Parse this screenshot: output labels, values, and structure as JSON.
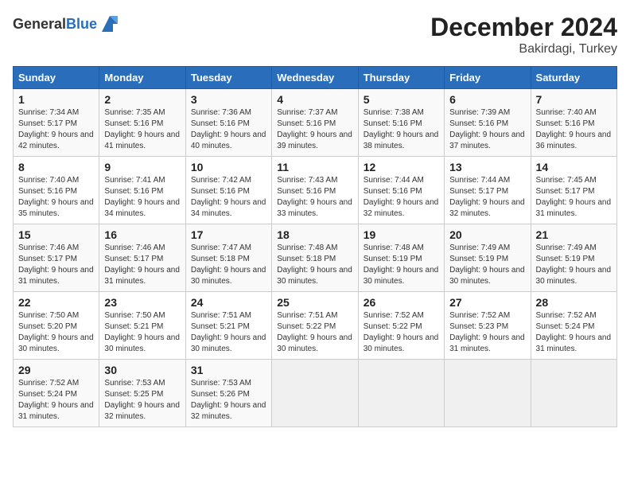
{
  "header": {
    "logo_general": "General",
    "logo_blue": "Blue",
    "month": "December 2024",
    "location": "Bakirdagi, Turkey"
  },
  "weekdays": [
    "Sunday",
    "Monday",
    "Tuesday",
    "Wednesday",
    "Thursday",
    "Friday",
    "Saturday"
  ],
  "weeks": [
    [
      {
        "day": "1",
        "sunrise": "Sunrise: 7:34 AM",
        "sunset": "Sunset: 5:17 PM",
        "daylight": "Daylight: 9 hours and 42 minutes."
      },
      {
        "day": "2",
        "sunrise": "Sunrise: 7:35 AM",
        "sunset": "Sunset: 5:16 PM",
        "daylight": "Daylight: 9 hours and 41 minutes."
      },
      {
        "day": "3",
        "sunrise": "Sunrise: 7:36 AM",
        "sunset": "Sunset: 5:16 PM",
        "daylight": "Daylight: 9 hours and 40 minutes."
      },
      {
        "day": "4",
        "sunrise": "Sunrise: 7:37 AM",
        "sunset": "Sunset: 5:16 PM",
        "daylight": "Daylight: 9 hours and 39 minutes."
      },
      {
        "day": "5",
        "sunrise": "Sunrise: 7:38 AM",
        "sunset": "Sunset: 5:16 PM",
        "daylight": "Daylight: 9 hours and 38 minutes."
      },
      {
        "day": "6",
        "sunrise": "Sunrise: 7:39 AM",
        "sunset": "Sunset: 5:16 PM",
        "daylight": "Daylight: 9 hours and 37 minutes."
      },
      {
        "day": "7",
        "sunrise": "Sunrise: 7:40 AM",
        "sunset": "Sunset: 5:16 PM",
        "daylight": "Daylight: 9 hours and 36 minutes."
      }
    ],
    [
      {
        "day": "8",
        "sunrise": "Sunrise: 7:40 AM",
        "sunset": "Sunset: 5:16 PM",
        "daylight": "Daylight: 9 hours and 35 minutes."
      },
      {
        "day": "9",
        "sunrise": "Sunrise: 7:41 AM",
        "sunset": "Sunset: 5:16 PM",
        "daylight": "Daylight: 9 hours and 34 minutes."
      },
      {
        "day": "10",
        "sunrise": "Sunrise: 7:42 AM",
        "sunset": "Sunset: 5:16 PM",
        "daylight": "Daylight: 9 hours and 34 minutes."
      },
      {
        "day": "11",
        "sunrise": "Sunrise: 7:43 AM",
        "sunset": "Sunset: 5:16 PM",
        "daylight": "Daylight: 9 hours and 33 minutes."
      },
      {
        "day": "12",
        "sunrise": "Sunrise: 7:44 AM",
        "sunset": "Sunset: 5:16 PM",
        "daylight": "Daylight: 9 hours and 32 minutes."
      },
      {
        "day": "13",
        "sunrise": "Sunrise: 7:44 AM",
        "sunset": "Sunset: 5:17 PM",
        "daylight": "Daylight: 9 hours and 32 minutes."
      },
      {
        "day": "14",
        "sunrise": "Sunrise: 7:45 AM",
        "sunset": "Sunset: 5:17 PM",
        "daylight": "Daylight: 9 hours and 31 minutes."
      }
    ],
    [
      {
        "day": "15",
        "sunrise": "Sunrise: 7:46 AM",
        "sunset": "Sunset: 5:17 PM",
        "daylight": "Daylight: 9 hours and 31 minutes."
      },
      {
        "day": "16",
        "sunrise": "Sunrise: 7:46 AM",
        "sunset": "Sunset: 5:17 PM",
        "daylight": "Daylight: 9 hours and 31 minutes."
      },
      {
        "day": "17",
        "sunrise": "Sunrise: 7:47 AM",
        "sunset": "Sunset: 5:18 PM",
        "daylight": "Daylight: 9 hours and 30 minutes."
      },
      {
        "day": "18",
        "sunrise": "Sunrise: 7:48 AM",
        "sunset": "Sunset: 5:18 PM",
        "daylight": "Daylight: 9 hours and 30 minutes."
      },
      {
        "day": "19",
        "sunrise": "Sunrise: 7:48 AM",
        "sunset": "Sunset: 5:19 PM",
        "daylight": "Daylight: 9 hours and 30 minutes."
      },
      {
        "day": "20",
        "sunrise": "Sunrise: 7:49 AM",
        "sunset": "Sunset: 5:19 PM",
        "daylight": "Daylight: 9 hours and 30 minutes."
      },
      {
        "day": "21",
        "sunrise": "Sunrise: 7:49 AM",
        "sunset": "Sunset: 5:19 PM",
        "daylight": "Daylight: 9 hours and 30 minutes."
      }
    ],
    [
      {
        "day": "22",
        "sunrise": "Sunrise: 7:50 AM",
        "sunset": "Sunset: 5:20 PM",
        "daylight": "Daylight: 9 hours and 30 minutes."
      },
      {
        "day": "23",
        "sunrise": "Sunrise: 7:50 AM",
        "sunset": "Sunset: 5:21 PM",
        "daylight": "Daylight: 9 hours and 30 minutes."
      },
      {
        "day": "24",
        "sunrise": "Sunrise: 7:51 AM",
        "sunset": "Sunset: 5:21 PM",
        "daylight": "Daylight: 9 hours and 30 minutes."
      },
      {
        "day": "25",
        "sunrise": "Sunrise: 7:51 AM",
        "sunset": "Sunset: 5:22 PM",
        "daylight": "Daylight: 9 hours and 30 minutes."
      },
      {
        "day": "26",
        "sunrise": "Sunrise: 7:52 AM",
        "sunset": "Sunset: 5:22 PM",
        "daylight": "Daylight: 9 hours and 30 minutes."
      },
      {
        "day": "27",
        "sunrise": "Sunrise: 7:52 AM",
        "sunset": "Sunset: 5:23 PM",
        "daylight": "Daylight: 9 hours and 31 minutes."
      },
      {
        "day": "28",
        "sunrise": "Sunrise: 7:52 AM",
        "sunset": "Sunset: 5:24 PM",
        "daylight": "Daylight: 9 hours and 31 minutes."
      }
    ],
    [
      {
        "day": "29",
        "sunrise": "Sunrise: 7:52 AM",
        "sunset": "Sunset: 5:24 PM",
        "daylight": "Daylight: 9 hours and 31 minutes."
      },
      {
        "day": "30",
        "sunrise": "Sunrise: 7:53 AM",
        "sunset": "Sunset: 5:25 PM",
        "daylight": "Daylight: 9 hours and 32 minutes."
      },
      {
        "day": "31",
        "sunrise": "Sunrise: 7:53 AM",
        "sunset": "Sunset: 5:26 PM",
        "daylight": "Daylight: 9 hours and 32 minutes."
      },
      null,
      null,
      null,
      null
    ]
  ]
}
